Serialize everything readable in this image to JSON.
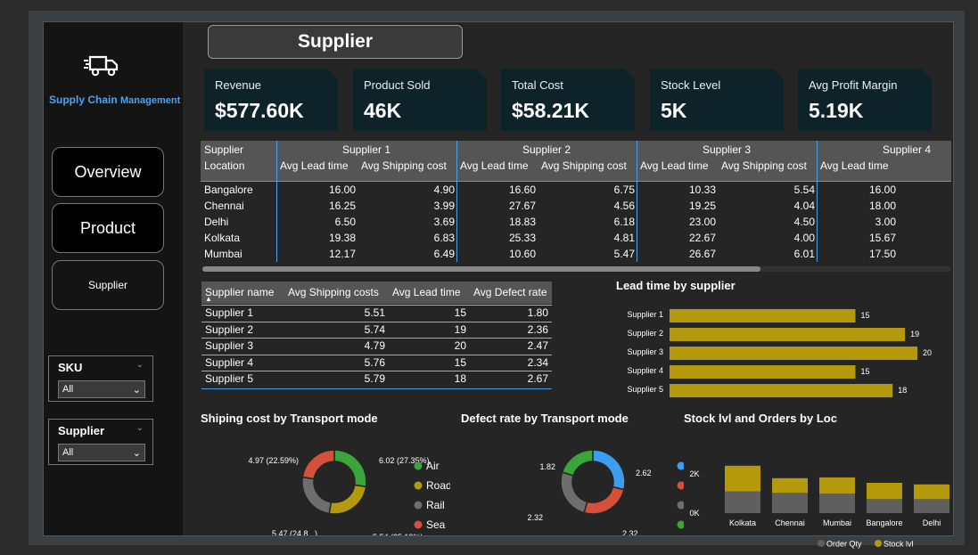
{
  "sidebar": {
    "brand_main": "Supply Chain",
    "brand_sub": "Management",
    "nav": [
      {
        "label": "Overview"
      },
      {
        "label": "Product"
      },
      {
        "label": "Supplier"
      }
    ],
    "slicers": [
      {
        "title": "SKU",
        "value": "All"
      },
      {
        "title": "Supplier",
        "value": "All"
      }
    ]
  },
  "page": {
    "title": "Supplier"
  },
  "kpis": [
    {
      "label": "Revenue",
      "value": "$577.60K"
    },
    {
      "label": "Product Sold",
      "value": "46K"
    },
    {
      "label": "Total Cost",
      "value": "$58.21K"
    },
    {
      "label": "Stock Level",
      "value": "5K"
    },
    {
      "label": "Avg Profit Margin",
      "value": "5.19K"
    }
  ],
  "matrix": {
    "row_header": "Supplier",
    "col_header": "Location",
    "suppliers": [
      "Supplier 1",
      "Supplier 2",
      "Supplier 3",
      "Supplier 4"
    ],
    "measures": [
      "Avg Lead time",
      "Avg Shipping cost"
    ],
    "rows": [
      {
        "location": "Bangalore",
        "values": [
          "16.00",
          "4.90",
          "16.60",
          "6.75",
          "10.33",
          "5.54",
          "16.00"
        ]
      },
      {
        "location": "Chennai",
        "values": [
          "16.25",
          "3.99",
          "27.67",
          "4.56",
          "19.25",
          "4.04",
          "18.00"
        ]
      },
      {
        "location": "Delhi",
        "values": [
          "6.50",
          "3.69",
          "18.83",
          "6.18",
          "23.00",
          "4.50",
          "3.00"
        ]
      },
      {
        "location": "Kolkata",
        "values": [
          "19.38",
          "6.83",
          "25.33",
          "4.81",
          "22.67",
          "4.00",
          "15.67"
        ]
      },
      {
        "location": "Mumbai",
        "values": [
          "12.17",
          "6.49",
          "10.60",
          "5.47",
          "26.67",
          "6.01",
          "17.50"
        ]
      }
    ]
  },
  "supplier_table": {
    "headers": [
      "Supplier name",
      "Avg Shipping costs",
      "Avg Lead time",
      "Avg Defect rate"
    ],
    "rows": [
      [
        "Supplier 1",
        "5.51",
        "15",
        "1.80"
      ],
      [
        "Supplier 2",
        "5.74",
        "19",
        "2.36"
      ],
      [
        "Supplier 3",
        "4.79",
        "20",
        "2.47"
      ],
      [
        "Supplier 4",
        "5.76",
        "15",
        "2.34"
      ],
      [
        "Supplier 5",
        "5.79",
        "18",
        "2.67"
      ]
    ]
  },
  "chart_data": [
    {
      "type": "bar",
      "title": "Lead time by supplier",
      "orientation": "horizontal",
      "categories": [
        "Supplier 1",
        "Supplier 2",
        "Supplier 3",
        "Supplier 4",
        "Supplier 5"
      ],
      "values": [
        15,
        19,
        20,
        15,
        18
      ],
      "color": "#b5990d"
    },
    {
      "type": "pie",
      "title": "Shiping cost by Transport mode",
      "donut": true,
      "labels": [
        "Air",
        "Road",
        "Rail",
        "Sea"
      ],
      "values": [
        6.02,
        5.54,
        5.47,
        4.97
      ],
      "data_labels": [
        "6.02 (27.35%)",
        "5.54 (25.19%)",
        "5.47 (24.8...)",
        "4.97 (22.59%)"
      ],
      "colors": [
        "#3aa53a",
        "#b5990d",
        "#6e6e6e",
        "#d4503a"
      ]
    },
    {
      "type": "pie",
      "title": "Defect rate by Transport mode",
      "donut": true,
      "labels": [
        "Road",
        "Rail",
        "Sea",
        "Air"
      ],
      "values": [
        2.62,
        2.32,
        2.32,
        1.82
      ],
      "data_labels": [
        "2.62",
        "2.32",
        "2.32",
        "1.82"
      ],
      "colors": [
        "#3d9df0",
        "#d4503a",
        "#6e6e6e",
        "#3aa53a"
      ]
    },
    {
      "type": "bar",
      "title": "Stock lvl and Orders by Loc",
      "stacked": true,
      "categories": [
        "Kolkata",
        "Chennai",
        "Mumbai",
        "Bangalore",
        "Delhi"
      ],
      "series": [
        {
          "name": "Order Qty",
          "values": [
            1400,
            1300,
            1250,
            900,
            900
          ],
          "color": "#5f5f5f"
        },
        {
          "name": "Stock lvl",
          "values": [
            1650,
            950,
            1050,
            1050,
            950
          ],
          "color": "#b5990d"
        }
      ],
      "yticks": [
        "2K",
        "0K"
      ],
      "ylim": [
        0,
        3200
      ]
    }
  ]
}
